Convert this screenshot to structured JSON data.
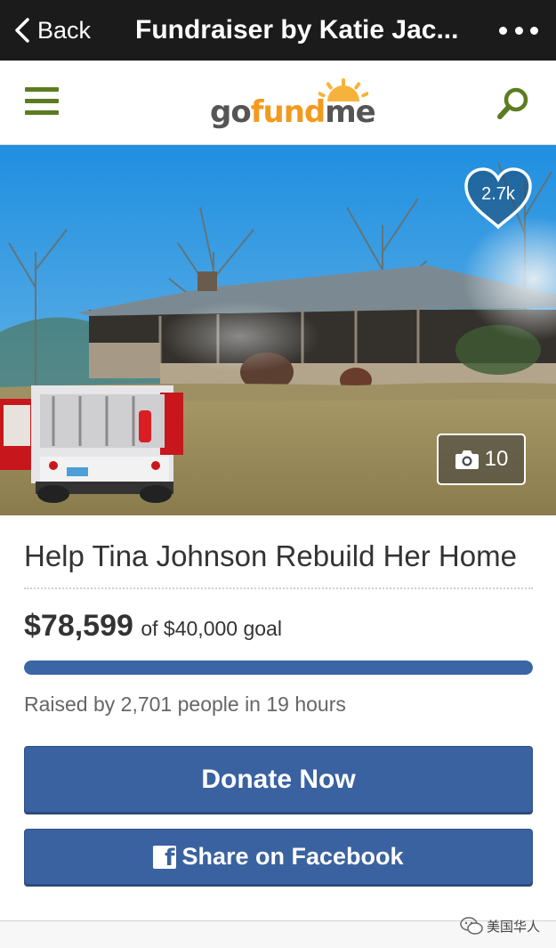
{
  "topbar": {
    "back_label": "Back",
    "title": "Fundraiser by Katie Jac...",
    "more_icon": "more-dots-icon"
  },
  "site_header": {
    "menu_icon": "hamburger-menu-icon",
    "logo_text_prefix": "go",
    "logo_text_accent": "fund",
    "logo_text_suffix": "me",
    "search_icon": "search-icon",
    "brand_color": "#5c7c1f",
    "logo_accent_color": "#f39a1d"
  },
  "hero": {
    "heart_count": "2.7k",
    "photo_count": "10",
    "camera_icon": "camera-icon"
  },
  "campaign": {
    "title": "Help Tina Johnson Rebuild Her Home",
    "amount_raised": "$78,599",
    "goal_text": "of $40,000 goal",
    "progress_percent": 100,
    "progress_color": "#3a66a6",
    "raised_text": "Raised by 2,701 people in 19 hours"
  },
  "actions": {
    "donate_label": "Donate Now",
    "share_label": "Share on Facebook",
    "button_color": "#3a62a0"
  },
  "watermark": {
    "text": "美国华人"
  }
}
